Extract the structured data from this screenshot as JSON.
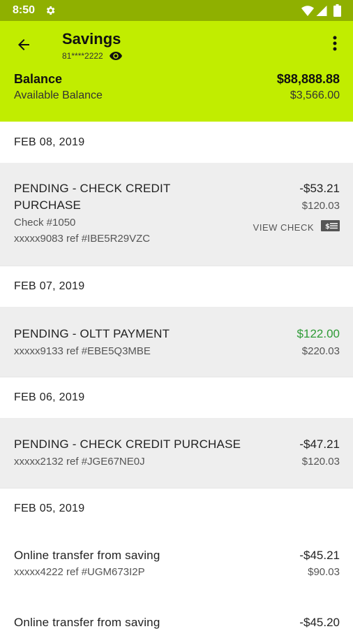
{
  "status_bar": {
    "time": "8:50"
  },
  "header": {
    "title": "Savings",
    "account_number": "81****2222",
    "balance_label": "Balance",
    "balance_value": "$88,888.88",
    "available_label": "Available Balance",
    "available_value": "$3,566.00"
  },
  "groups": [
    {
      "date": "FEB 08, 2019"
    },
    {
      "date": "FEB 07, 2019"
    },
    {
      "date": "FEB 06, 2019"
    },
    {
      "date": "FEB 05, 2019"
    }
  ],
  "transactions": [
    {
      "line1": "PENDING - CHECK CREDIT",
      "line2": "PURCHASE",
      "check": "Check #1050",
      "ref": "xxxxx9083 ref #IBE5R29VZC",
      "amount": "-$53.21",
      "balance": "$120.03",
      "action": "VIEW CHECK"
    },
    {
      "desc": "PENDING - OLTT PAYMENT",
      "ref": "xxxxx9133 ref #EBE5Q3MBE",
      "amount": "$122.00",
      "balance": "$220.03"
    },
    {
      "desc": "PENDING - CHECK CREDIT PURCHASE",
      "ref": "xxxxx2132 ref #JGE67NE0J",
      "amount": "-$47.21",
      "balance": "$120.03"
    },
    {
      "desc": "Online transfer from saving",
      "ref": "xxxxx4222 ref #UGM673I2P",
      "amount": "-$45.21",
      "balance": "$90.03"
    },
    {
      "desc": "Online transfer from saving",
      "amount": "-$45.20"
    }
  ],
  "colors": {
    "header_bg": "#c1ed00",
    "status_bar_bg": "#8fb000",
    "credit_amount": "#2e9a36",
    "pending_row_bg": "#eeeeee"
  },
  "icons": [
    "settings-gear-icon",
    "wifi-icon",
    "signal-icon",
    "battery-icon",
    "back-arrow-icon",
    "eye-icon",
    "more-vert-icon",
    "check-icon"
  ]
}
